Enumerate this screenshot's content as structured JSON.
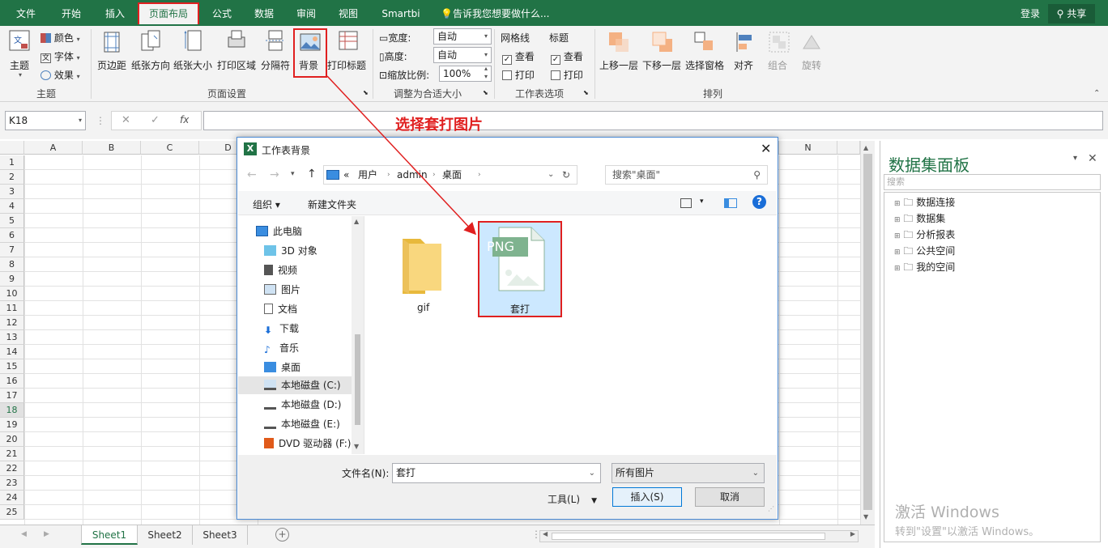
{
  "tabs": [
    "文件",
    "开始",
    "插入",
    "页面布局",
    "公式",
    "数据",
    "审阅",
    "视图",
    "Smartbi"
  ],
  "active_tab": "页面布局",
  "tell_me": "告诉我您想要做什么...",
  "login": "登录",
  "share": "共享",
  "ribbon": {
    "theme": {
      "main": "主题",
      "colors": "颜色",
      "fonts": "字体",
      "effects": "效果",
      "group": "主题"
    },
    "page_setup": {
      "margins": "页边距",
      "orientation": "纸张方向",
      "size": "纸张大小",
      "print_area": "打印区域",
      "breaks": "分隔符",
      "background": "背景",
      "print_titles": "打印标题",
      "group": "页面设置"
    },
    "scale": {
      "width_label": "宽度:",
      "width_value": "自动",
      "height_label": "高度:",
      "height_value": "自动",
      "scale_label": "缩放比例:",
      "scale_value": "100%",
      "group": "调整为合适大小"
    },
    "sheet_options": {
      "gridlines": "网格线",
      "headings": "标题",
      "view1": "查看",
      "print1": "打印",
      "view2": "查看",
      "print2": "打印",
      "group": "工作表选项"
    },
    "arrange": {
      "forward": "上移一层",
      "backward": "下移一层",
      "selection": "选择窗格",
      "align": "对齐",
      "group_btn": "组合",
      "rotate": "旋转",
      "group": "排列"
    }
  },
  "namebox": "K18",
  "fx": "fx",
  "annotation": "选择套打图片",
  "columns": [
    "A",
    "B",
    "C",
    "D",
    "N"
  ],
  "rows": [
    "1",
    "2",
    "3",
    "4",
    "5",
    "6",
    "7",
    "8",
    "9",
    "10",
    "11",
    "12",
    "13",
    "14",
    "15",
    "16",
    "17",
    "18",
    "19",
    "20",
    "21",
    "22",
    "23",
    "24",
    "25"
  ],
  "sheets": [
    "Sheet1",
    "Sheet2",
    "Sheet3"
  ],
  "dialog": {
    "title": "工作表背景",
    "path": [
      "用户",
      "admin",
      "桌面"
    ],
    "path_prefix": "«",
    "search_placeholder": "搜索\"桌面\"",
    "organize": "组织 ▾",
    "new_folder": "新建文件夹",
    "nav": [
      "此电脑",
      "3D 对象",
      "视频",
      "图片",
      "文档",
      "下载",
      "音乐",
      "桌面",
      "本地磁盘 (C:)",
      "本地磁盘 (D:)",
      "本地磁盘 (E:)",
      "DVD 驱动器 (F:)"
    ],
    "files": [
      {
        "name": "gif",
        "type": "folder"
      },
      {
        "name": "套打",
        "type": "png",
        "badge": "PNG"
      }
    ],
    "filename_label": "文件名(N):",
    "filename_value": "套打",
    "filetype_value": "所有图片",
    "tools": "工具(L)",
    "insert": "插入(S)",
    "cancel": "取消"
  },
  "panel": {
    "title": "数据集面板",
    "search_placeholder": "搜索",
    "items": [
      "数据连接",
      "数据集",
      "分析报表",
      "公共空间",
      "我的空间"
    ]
  },
  "watermark": {
    "line1": "激活 Windows",
    "line2": "转到\"设置\"以激活 Windows。"
  },
  "colors": {
    "accent": "#217346",
    "annotation": "#e02020",
    "selection": "#cce8ff"
  }
}
